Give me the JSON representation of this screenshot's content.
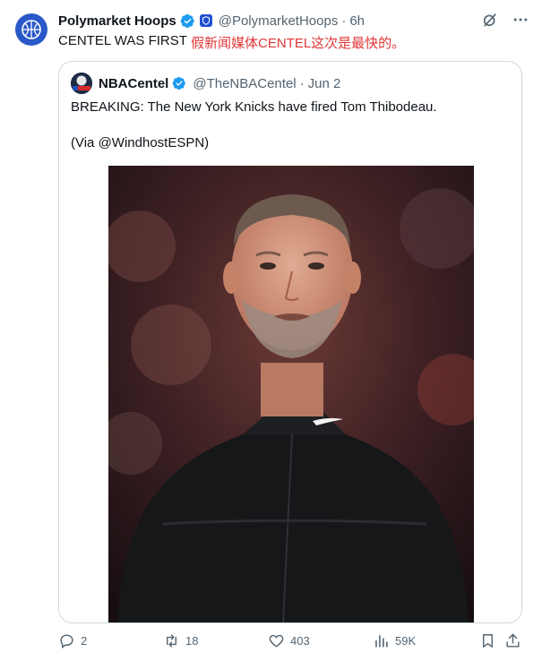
{
  "tweet": {
    "author_name": "Polymarket Hoops",
    "author_handle": "@PolymarketHoops",
    "separator": "·",
    "time": "6h",
    "text": "CENTEL WAS FIRST",
    "overlay_note": "假新闻媒体CENTEL这次是最快的。"
  },
  "quote": {
    "author_name": "NBACentel",
    "author_handle": "@TheNBACentel",
    "separator": "·",
    "date": "Jun 2",
    "line1": "BREAKING: The New York Knicks have fired Tom Thibodeau.",
    "line2": "(Via @WindhostESPN)"
  },
  "actions": {
    "replies": "2",
    "reposts": "18",
    "likes": "403",
    "views": "59K"
  },
  "colors": {
    "accent": "#1d9bf0",
    "secondary_text": "#536471",
    "overlay": "#e03636",
    "border": "#cfd9de"
  }
}
